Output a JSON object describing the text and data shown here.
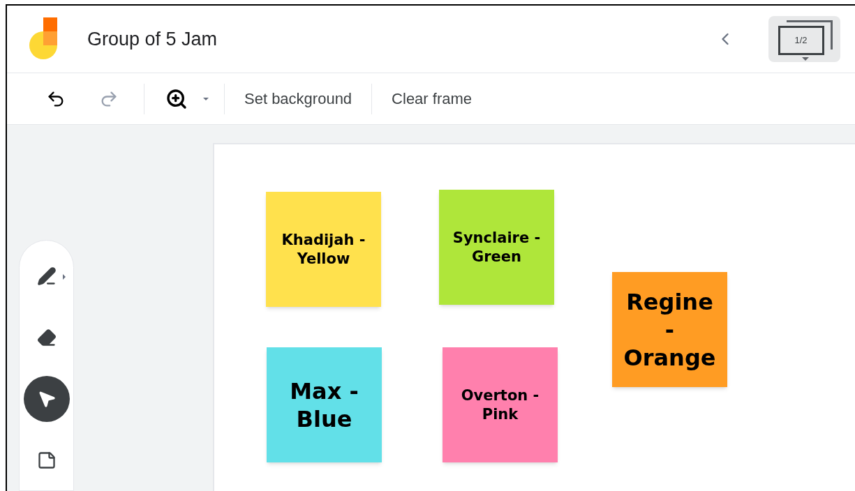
{
  "header": {
    "title": "Group of 5 Jam",
    "frame_counter": "1/2"
  },
  "toolbar": {
    "undo_disabled": false,
    "redo_disabled": true,
    "buttons": [
      "Set background",
      "Clear frame"
    ]
  },
  "tools": [
    {
      "kind": "pen",
      "selected": false
    },
    {
      "kind": "eraser",
      "selected": false
    },
    {
      "kind": "select",
      "selected": true
    },
    {
      "kind": "note",
      "selected": false
    }
  ],
  "notes": [
    {
      "text": "Khadijah - Yellow",
      "color": "#ffe14d"
    },
    {
      "text": "Synclaire - Green",
      "color": "#afe63a"
    },
    {
      "text": "Max - Blue",
      "color": "#62e0e8"
    },
    {
      "text": "Overton - Pink",
      "color": "#ff80ad"
    },
    {
      "text": "Regine - Orange",
      "color": "#ff9c23"
    }
  ]
}
